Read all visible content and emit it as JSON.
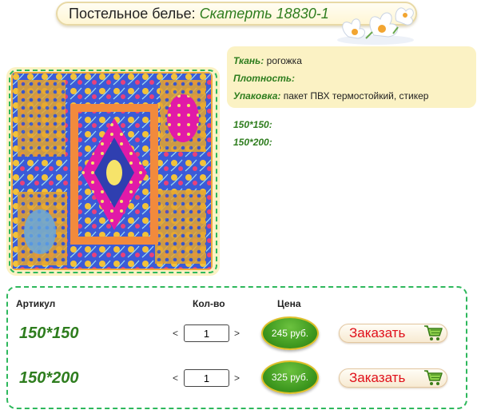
{
  "header": {
    "category": "Постельное белье:",
    "product_name": "Скатерть 18830-1"
  },
  "specs": {
    "fabric_label": "Ткань:",
    "fabric_value": "рогожка",
    "density_label": "Плотность:",
    "density_value": "",
    "packaging_label": "Упаковка:",
    "packaging_value": "пакет ПВХ термостойкий, стикер"
  },
  "sizes": [
    "150*150:",
    "150*200:"
  ],
  "table": {
    "col_article": "Артикул",
    "col_qty": "Кол-во",
    "col_price": "Цена",
    "rows": [
      {
        "article": "150*150",
        "qty": "1",
        "price": "245 руб.",
        "order_label": "Заказать",
        "dec": "<",
        "inc": ">"
      },
      {
        "article": "150*200",
        "qty": "1",
        "price": "325 руб.",
        "order_label": "Заказать",
        "dec": "<",
        "inc": ">"
      }
    ]
  },
  "colors": {
    "accent_green": "#2e7d1e",
    "panel_cream": "#fbf2c4",
    "order_red": "#e0101a",
    "dash_green": "#2eb85c"
  },
  "icons": [
    "flower-decoration-icon",
    "cart-icon"
  ]
}
